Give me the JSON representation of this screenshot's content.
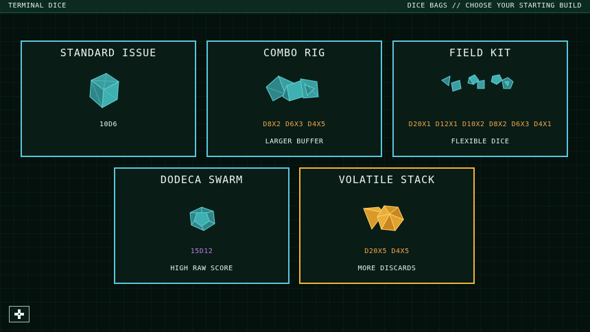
{
  "header": {
    "title": "TERMINAL DICE",
    "subtitle": "DICE BAGS // CHOOSE YOUR STARTING BUILD"
  },
  "colors": {
    "accent_cyan": "#58c6de",
    "accent_orange": "#f0b23a",
    "dice_orange": "#f0a848",
    "dice_purple": "#c07be6",
    "background": "#04110c"
  },
  "bags": [
    {
      "name": "STANDARD ISSUE",
      "dice": "10D6",
      "perk": "",
      "icon": "d6-cube-icon",
      "dice_color": "white",
      "selected": false
    },
    {
      "name": "COMBO RIG",
      "dice": "D8X2 D6X3 D4X5",
      "perk": "LARGER BUFFER",
      "icon": "mixed-dice-cluster-icon",
      "dice_color": "orange",
      "selected": false
    },
    {
      "name": "FIELD KIT",
      "dice": "D20X1 D12X1 D10X2 D8X2 D6X3 D4X1",
      "perk": "FLEXIBLE DICE",
      "icon": "assorted-dice-icon",
      "dice_color": "orange",
      "selected": false
    },
    {
      "name": "DODECA SWARM",
      "dice": "15D12",
      "perk": "HIGH RAW SCORE",
      "icon": "d12-dodecahedron-icon",
      "dice_color": "purple",
      "selected": false
    },
    {
      "name": "VOLATILE STACK",
      "dice": "D20X5 D4X5",
      "perk": "MORE DISCARDS",
      "icon": "d20-d4-cluster-icon",
      "dice_color": "orange",
      "selected": true
    }
  ],
  "corner_button": {
    "icon": "dpad-icon"
  }
}
